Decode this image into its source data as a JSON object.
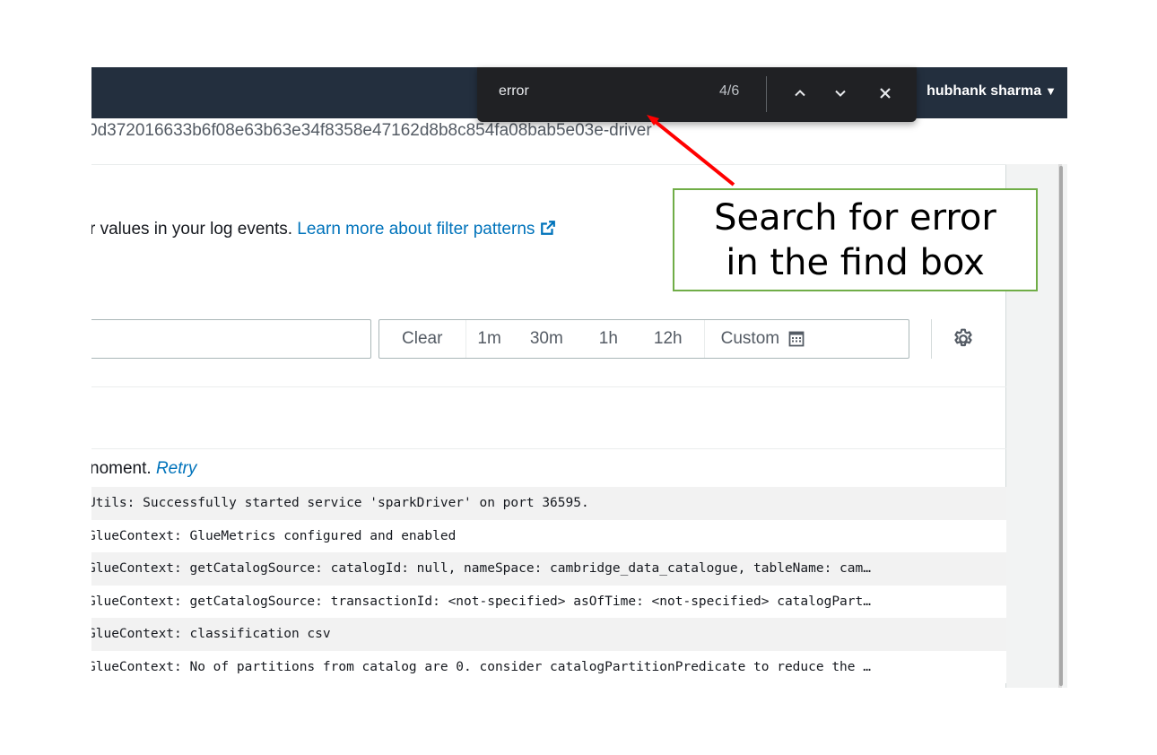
{
  "topbar": {
    "user_name": "hubhank sharma",
    "user_caret": "▼"
  },
  "log_stream": {
    "name": "0d372016633b6f08e63b63e34f8358e47162d8b8c854fa08bab5e03e-driver"
  },
  "filter": {
    "description_prefix": "r values in your log events. ",
    "learn_more_link": "Learn more about filter patterns",
    "input_value": ""
  },
  "time_range": {
    "clear_label": "Clear",
    "options": [
      "1m",
      "30m",
      "1h",
      "12h"
    ],
    "custom_label": "Custom"
  },
  "notice": {
    "text": "noment. ",
    "retry_label": "Retry"
  },
  "log_events": [
    "Utils: Successfully started service 'sparkDriver' on port 36595.",
    "GlueContext: GlueMetrics configured and enabled",
    "GlueContext: getCatalogSource: catalogId: null, nameSpace: cambridge_data_catalogue, tableName: cam…",
    "GlueContext: getCatalogSource: transactionId: <not-specified> asOfTime: <not-specified> catalogPart…",
    "GlueContext: classification csv",
    "GlueContext: No of partitions from catalog are 0. consider catalogPartitionPredicate to reduce the …"
  ],
  "find_bar": {
    "query": "error",
    "match_count": "4/6"
  },
  "callout": {
    "line1": "Search for error",
    "line2": "in the find box"
  },
  "colors": {
    "topbar_bg": "#232f3e",
    "link": "#0073bb",
    "findbar_bg": "#202124",
    "callout_border": "#70ad47",
    "arrow": "#ff0000"
  }
}
